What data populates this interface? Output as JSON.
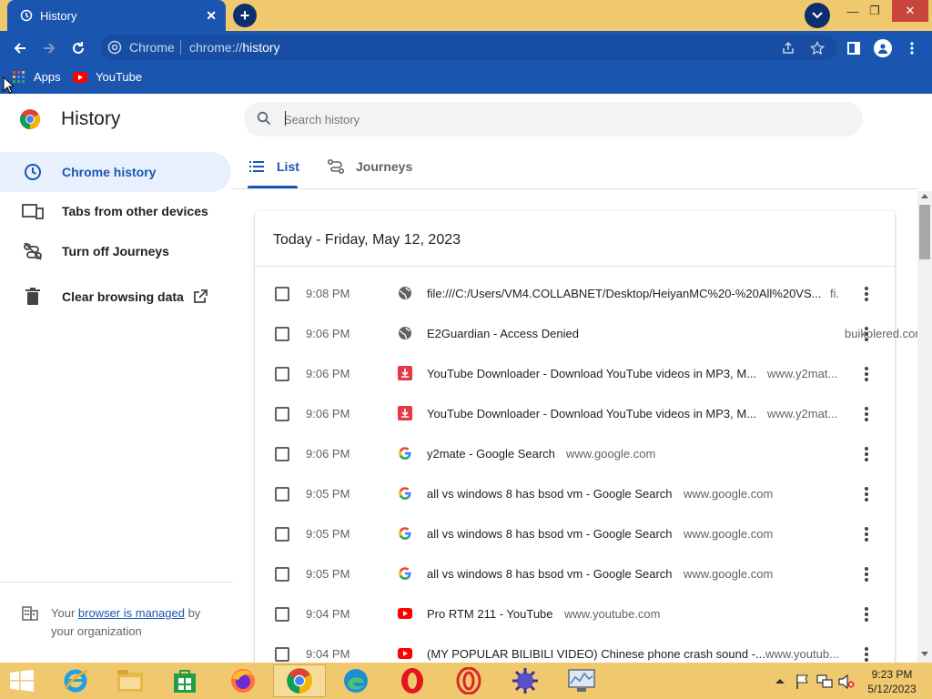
{
  "window": {
    "tab_title": "History",
    "new_tab": "+",
    "minimize": "—",
    "restore": "❐",
    "close": "✕"
  },
  "toolbar": {
    "site_label": "Chrome",
    "url_prefix": "chrome://",
    "url_path": "history"
  },
  "bookmarks": [
    {
      "label": "Apps"
    },
    {
      "label": "YouTube"
    }
  ],
  "sidebar": {
    "title": "History",
    "items": [
      {
        "label": "Chrome history",
        "icon": "clock-icon"
      },
      {
        "label": "Tabs from other devices",
        "icon": "devices-icon"
      },
      {
        "label": "Turn off Journeys",
        "icon": "journeys-off-icon"
      },
      {
        "label": "Clear browsing data",
        "icon": "trash-icon"
      }
    ],
    "managed_prefix": "Your ",
    "managed_link": "browser is managed",
    "managed_suffix": " by your organization"
  },
  "search": {
    "placeholder": "Search history"
  },
  "history_tabs": [
    {
      "label": "List"
    },
    {
      "label": "Journeys"
    }
  ],
  "day_header": "Today - Friday, May 12, 2023",
  "entries": [
    {
      "time": "9:08 PM",
      "title": "file:///C:/Users/VM4.COLLABNET/Desktop/HeiyanMC%20-%20All%20VS...",
      "domain": "fi.",
      "favicon": "globe-icon"
    },
    {
      "time": "9:06 PM",
      "title": "E2Guardian - Access Denied",
      "domain": "buikolered.com",
      "favicon": "globe-icon"
    },
    {
      "time": "9:06 PM",
      "title": "YouTube Downloader - Download YouTube videos in MP3, M...",
      "domain": "www.y2mat...",
      "favicon": "y2mate-icon"
    },
    {
      "time": "9:06 PM",
      "title": "YouTube Downloader - Download YouTube videos in MP3, M...",
      "domain": "www.y2mat...",
      "favicon": "y2mate-icon"
    },
    {
      "time": "9:06 PM",
      "title": "y2mate - Google Search",
      "domain": "www.google.com",
      "favicon": "google-icon"
    },
    {
      "time": "9:05 PM",
      "title": "all vs windows 8 has bsod vm - Google Search",
      "domain": "www.google.com",
      "favicon": "google-icon"
    },
    {
      "time": "9:05 PM",
      "title": "all vs windows 8 has bsod vm - Google Search",
      "domain": "www.google.com",
      "favicon": "google-icon"
    },
    {
      "time": "9:05 PM",
      "title": "all vs windows 8 has bsod vm - Google Search",
      "domain": "www.google.com",
      "favicon": "google-icon"
    },
    {
      "time": "9:04 PM",
      "title": "Pro RTM 211 - YouTube",
      "domain": "www.youtube.com",
      "favicon": "youtube-icon"
    },
    {
      "time": "9:04 PM",
      "title": "(MY POPULAR BILIBILI VIDEO) Chinese phone crash sound -...",
      "domain": "www.youtub...",
      "favicon": "youtube-icon"
    }
  ],
  "taskbar": {
    "time": "9:23 PM",
    "date": "5/12/2023"
  },
  "colors": {
    "accent": "#1a56b0",
    "frame": "#f0c96e"
  }
}
